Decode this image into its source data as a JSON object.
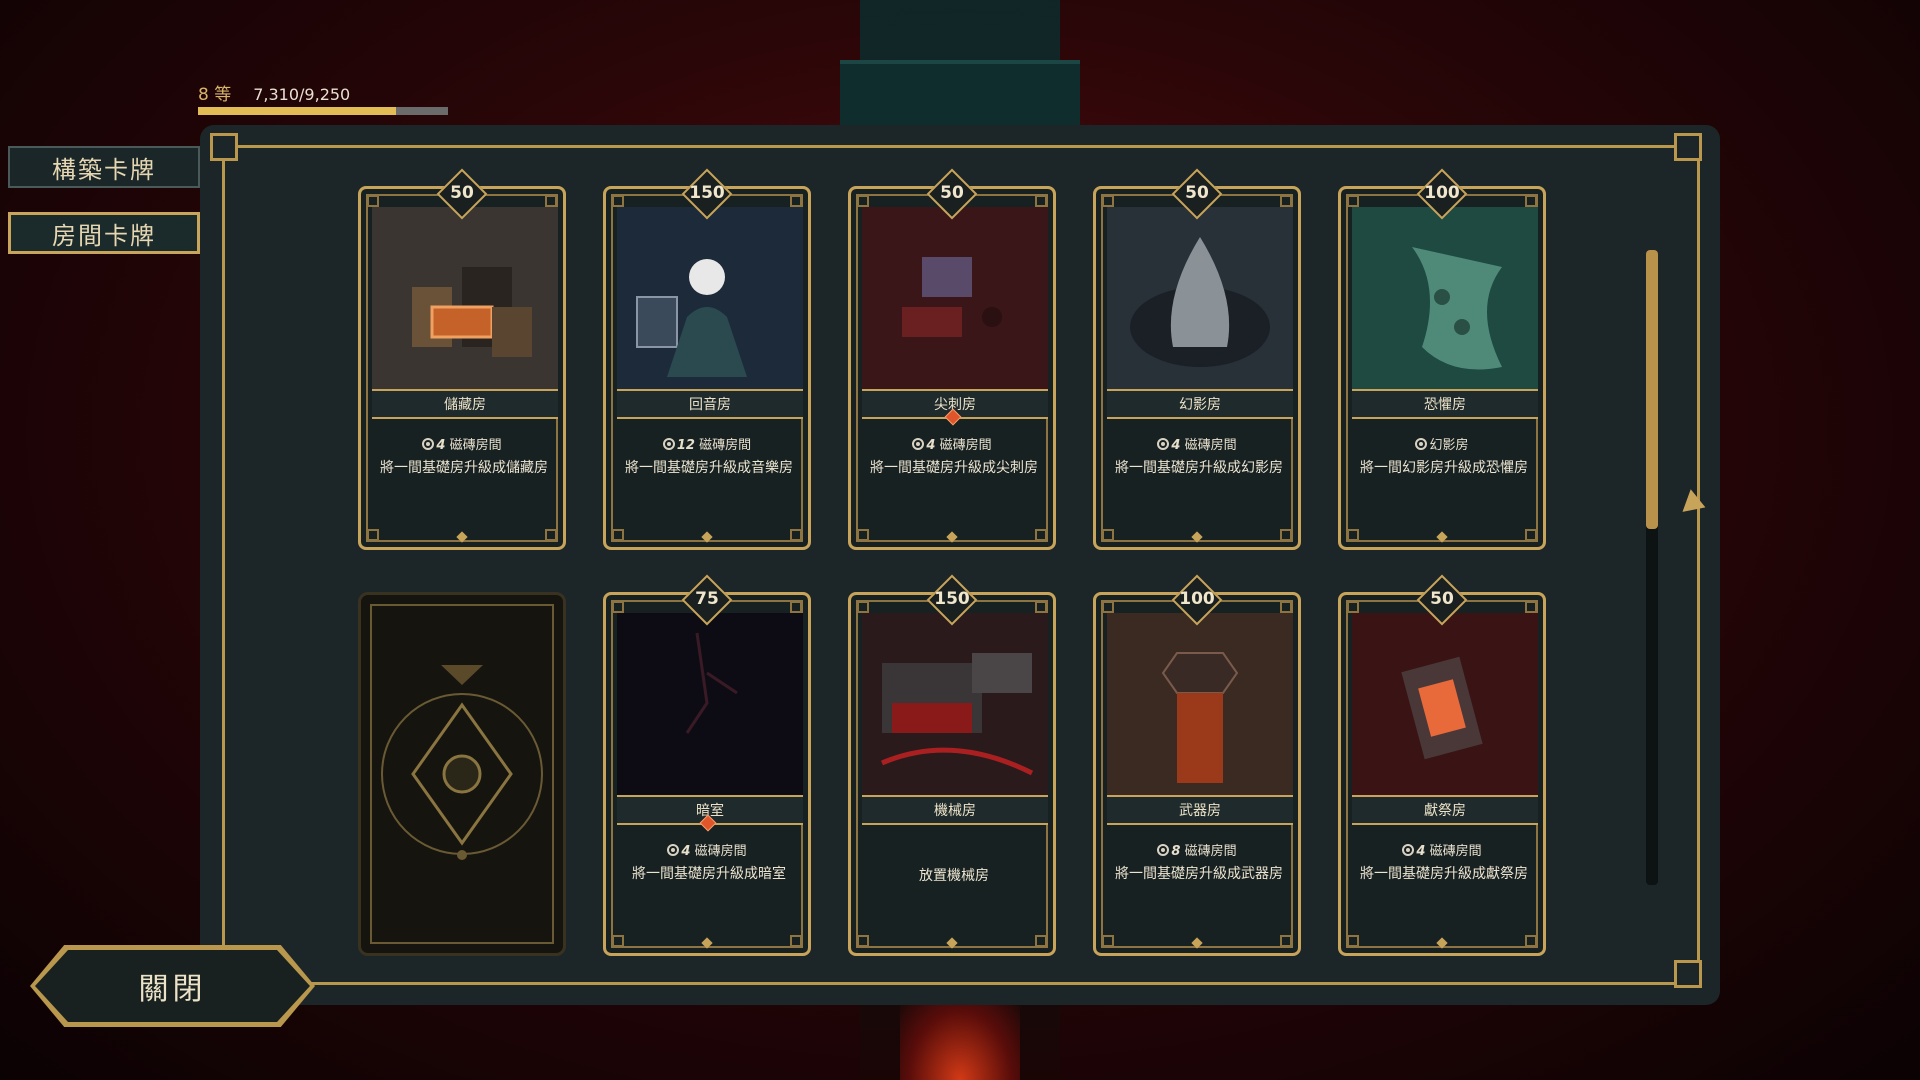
{
  "player": {
    "level_label": "8 等",
    "xp_text": "7,310/9,250",
    "xp_fraction": 0.79
  },
  "tabs": [
    {
      "label": "構築卡牌",
      "active": false
    },
    {
      "label": "房間卡牌",
      "active": true
    }
  ],
  "close_label": "關閉",
  "scroll": {
    "position_fraction": 0.0,
    "visible_fraction": 0.44
  },
  "cards": [
    {
      "cost": "50",
      "name": "儲藏房",
      "sub_num": "4",
      "sub_text": "磁磚房間",
      "desc": "將一間基礎房升級成儲藏房",
      "gem": false,
      "art": "storage",
      "color": "#3a3530"
    },
    {
      "cost": "150",
      "name": "回音房",
      "sub_num": "12",
      "sub_text": "磁磚房間",
      "desc": "將一間基礎房升級成音樂房",
      "gem": false,
      "art": "echo",
      "color": "#1d2a3a"
    },
    {
      "cost": "50",
      "name": "尖刺房",
      "sub_num": "4",
      "sub_text": "磁磚房間",
      "desc": "將一間基礎房升級成尖刺房",
      "gem": true,
      "art": "spike",
      "color": "#3a1618"
    },
    {
      "cost": "50",
      "name": "幻影房",
      "sub_num": "4",
      "sub_text": "磁磚房間",
      "desc": "將一間基礎房升級成幻影房",
      "gem": false,
      "art": "phantom",
      "color": "#283038"
    },
    {
      "cost": "100",
      "name": "恐懼房",
      "sub_num": "",
      "sub_text": "幻影房",
      "desc": "將一間幻影房升級成恐懼房",
      "gem": false,
      "art": "fear",
      "color": "#1e4a42"
    },
    {
      "cost": "",
      "name": "",
      "sub_num": "",
      "sub_text": "",
      "desc": "",
      "gem": false,
      "art": "back",
      "color": "#15140f"
    },
    {
      "cost": "75",
      "name": "暗室",
      "sub_num": "4",
      "sub_text": "磁磚房間",
      "desc": "將一間基礎房升級成暗室",
      "gem": true,
      "art": "dark",
      "color": "#0d0c14"
    },
    {
      "cost": "150",
      "name": "機械房",
      "sub_num": "",
      "sub_text": "",
      "desc": "放置機械房",
      "gem": false,
      "art": "machine",
      "color": "#2a1a1c"
    },
    {
      "cost": "100",
      "name": "武器房",
      "sub_num": "8",
      "sub_text": "磁磚房間",
      "desc": "將一間基礎房升級成武器房",
      "gem": false,
      "art": "weapon",
      "color": "#3a2a22"
    },
    {
      "cost": "50",
      "name": "獻祭房",
      "sub_num": "4",
      "sub_text": "磁磚房間",
      "desc": "將一間基礎房升級成獻祭房",
      "gem": false,
      "art": "sacrifice",
      "color": "#3a1414"
    }
  ]
}
